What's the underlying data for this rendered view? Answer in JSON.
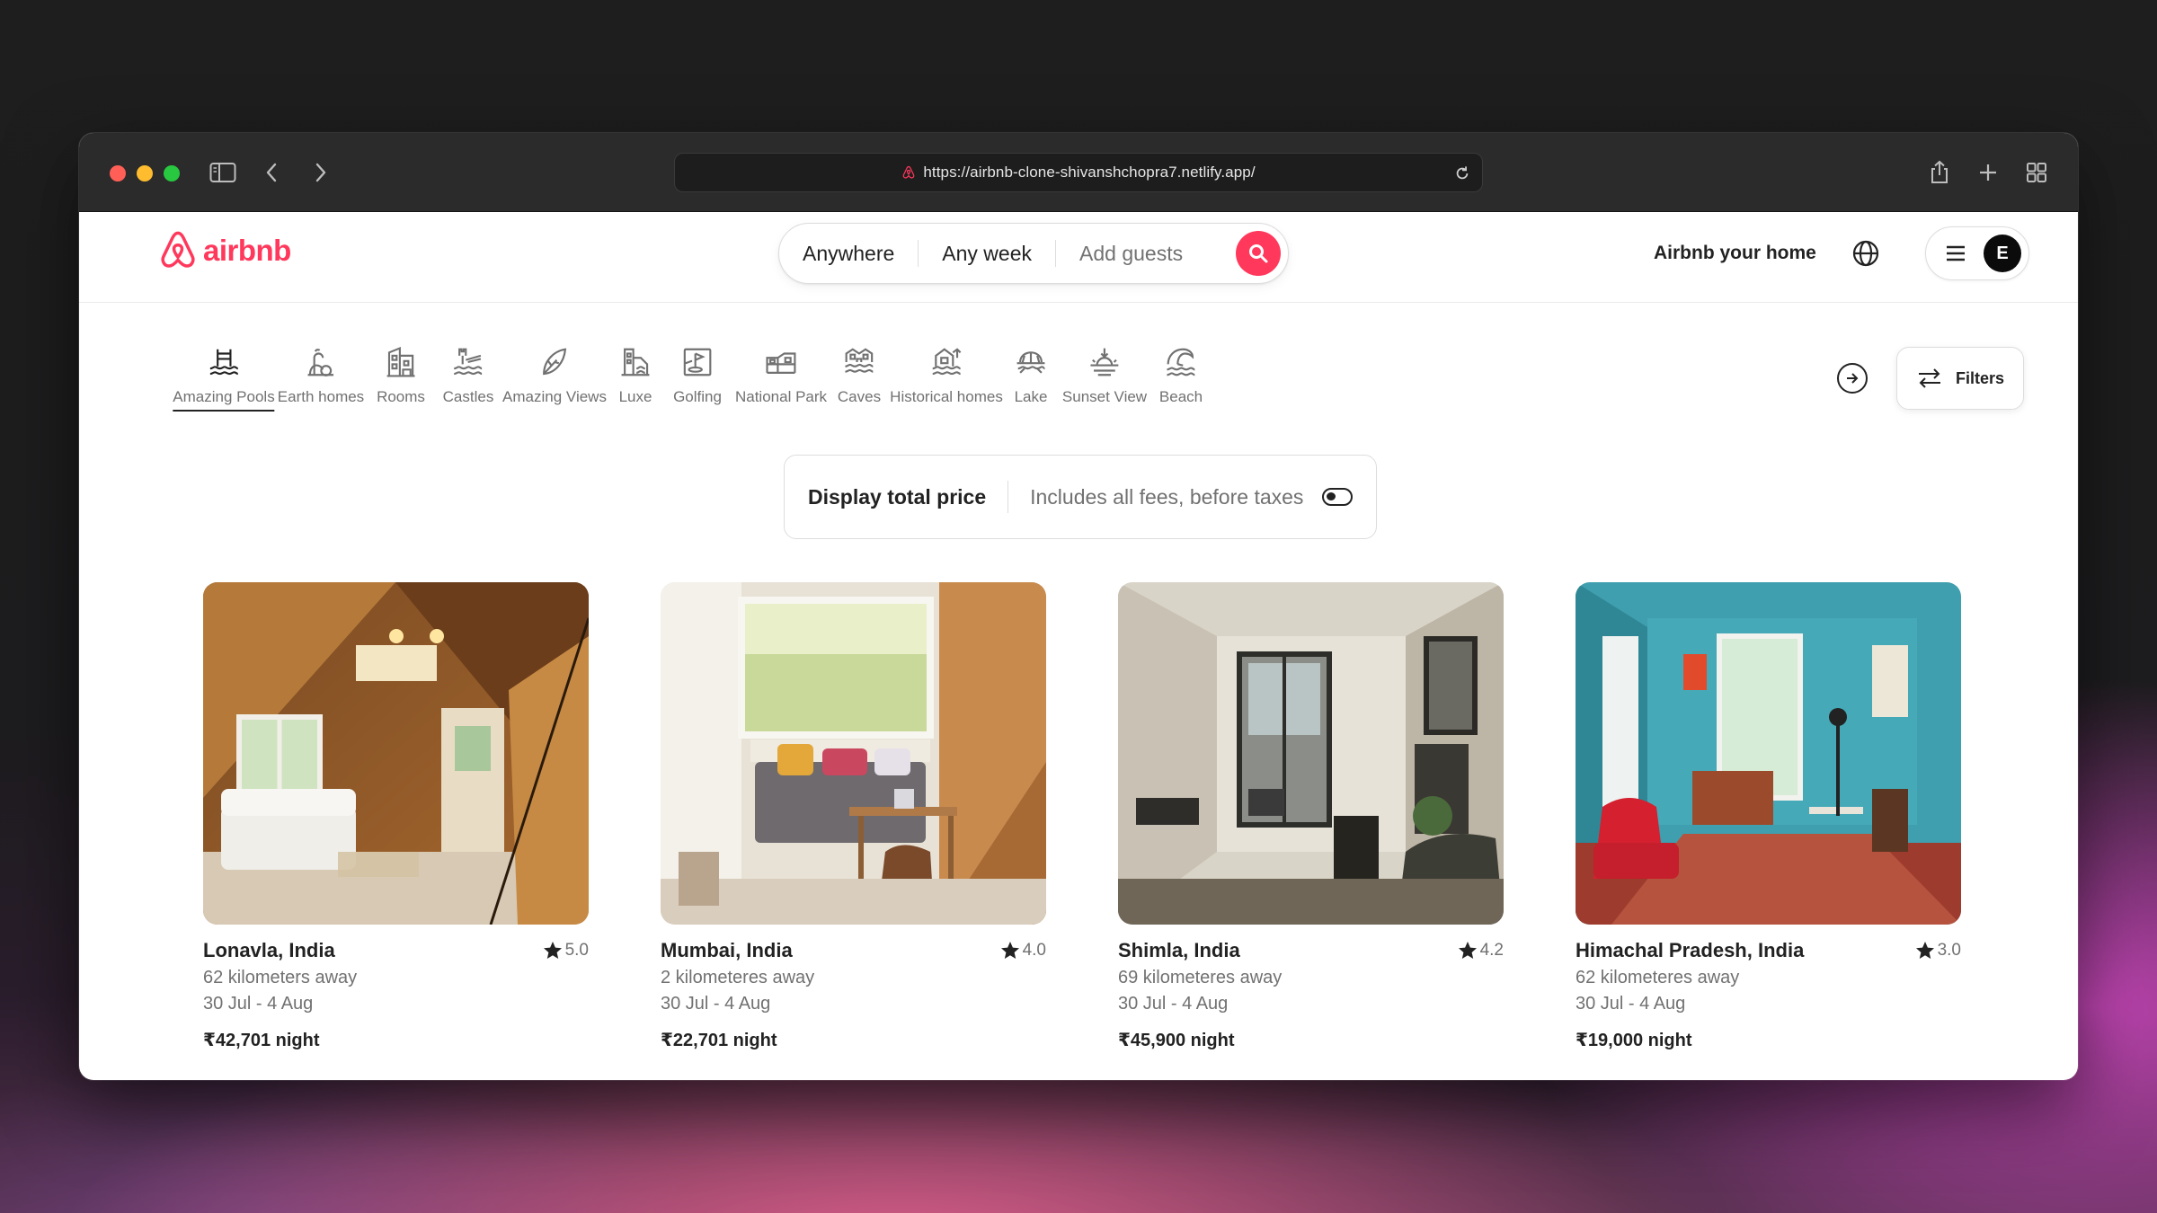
{
  "browser": {
    "url": "https://airbnb-clone-shivanshchopra7.netlify.app/"
  },
  "header": {
    "logo_text": "airbnb",
    "search": {
      "anywhere": "Anywhere",
      "any_week": "Any week",
      "add_guests": "Add guests"
    },
    "host_link": "Airbnb your home",
    "avatar_initial": "E",
    "brand_color": "#ff385c"
  },
  "categories": [
    {
      "label": "Amazing Pools",
      "icon": "pool-icon",
      "active": true
    },
    {
      "label": "Earth homes",
      "icon": "earth-home-icon",
      "active": false
    },
    {
      "label": "Rooms",
      "icon": "rooms-icon",
      "active": false
    },
    {
      "label": "Castles",
      "icon": "castle-icon",
      "active": false
    },
    {
      "label": "Amazing Views",
      "icon": "view-icon",
      "active": false
    },
    {
      "label": "Luxe",
      "icon": "luxe-icon",
      "active": false
    },
    {
      "label": "Golfing",
      "icon": "golf-icon",
      "active": false
    },
    {
      "label": "National Park",
      "icon": "park-icon",
      "active": false
    },
    {
      "label": "Caves",
      "icon": "cave-icon",
      "active": false
    },
    {
      "label": "Historical homes",
      "icon": "historical-home-icon",
      "active": false
    },
    {
      "label": "Lake",
      "icon": "lake-icon",
      "active": false
    },
    {
      "label": "Sunset View",
      "icon": "sunset-icon",
      "active": false
    },
    {
      "label": "Beach",
      "icon": "beach-icon",
      "active": false
    }
  ],
  "filters_label": "Filters",
  "price_toggle": {
    "title": "Display total price",
    "subtitle": "Includes all fees, before taxes"
  },
  "listings": [
    {
      "location": "Lonavla, India",
      "rating": "5.0",
      "distance": "62 kilometers away",
      "dates": "30 Jul - 4 Aug",
      "price": "₹42,701 night"
    },
    {
      "location": "Mumbai, India",
      "rating": "4.0",
      "distance": "2 kilometeres away",
      "dates": "30 Jul - 4 Aug",
      "price": "₹22,701 night"
    },
    {
      "location": "Shimla, India",
      "rating": "4.2",
      "distance": "69 kilometeres away",
      "dates": "30 Jul - 4 Aug",
      "price": "₹45,900 night"
    },
    {
      "location": "Himachal Pradesh, India",
      "rating": "3.0",
      "distance": "62 kilometeres away",
      "dates": "30 Jul - 4 Aug",
      "price": "₹19,000 night"
    }
  ]
}
